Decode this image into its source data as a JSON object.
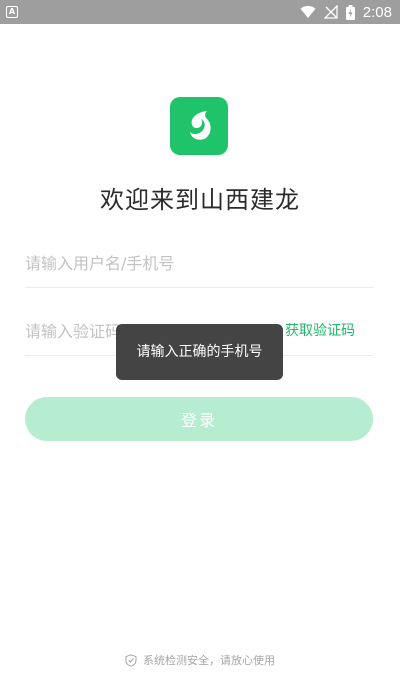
{
  "status_bar": {
    "notification_icon": "a-notification-icon",
    "icons": [
      "wifi-icon",
      "signal-off-icon",
      "battery-icon"
    ],
    "time": "2:08",
    "color": "#9e9e9e"
  },
  "logo": {
    "icon": "app-logo-icon",
    "color": "#1fc369"
  },
  "welcome_title": "欢迎来到山西建龙",
  "form": {
    "username_placeholder": "请输入用户名/手机号",
    "code_placeholder": "请输入验证码",
    "get_code_label": "获取验证码",
    "login_label": "登录",
    "accent": "#1fb86a",
    "login_bg": "#b6ecd0"
  },
  "toast": {
    "text": "请输入正确的手机号"
  },
  "footer": {
    "icon": "shield-check-icon",
    "text": "系统检测安全，请放心使用"
  }
}
